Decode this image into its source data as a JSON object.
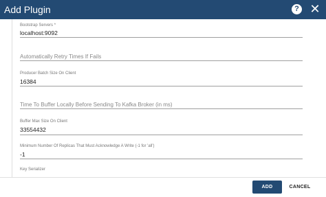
{
  "dialog": {
    "title": "Add Plugin",
    "help_icon": "question-circle-icon",
    "help_glyph": "?",
    "close_icon": "close-icon",
    "close_glyph": "✕",
    "accent_color": "#234a73"
  },
  "fields": [
    {
      "label": "Bootstrap Servers *",
      "value": "localhost:9092"
    },
    {
      "placeholder": "Automatically Retry Times If Fails"
    },
    {
      "label": "Producer Batch Size On Client",
      "value": "16384"
    },
    {
      "placeholder": "Time To Buffer Locally Before Sending To Kafka Broker (in ms)"
    },
    {
      "label": "Buffer Max Size On Client",
      "value": "33554432"
    },
    {
      "label": "Minimum Number Of Replicas That Must Acknowledge A Write (-1 for 'all')",
      "value": "-1"
    },
    {
      "label": "Key Serializer"
    }
  ],
  "footer": {
    "add_label": "ADD",
    "cancel_label": "CANCEL"
  }
}
